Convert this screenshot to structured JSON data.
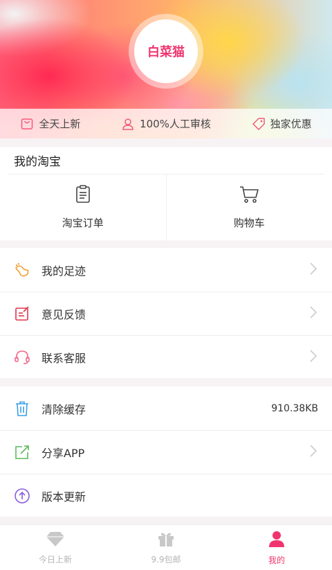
{
  "header": {
    "avatar_text": "白菜猫",
    "features": [
      {
        "icon": "shopping-bag-icon",
        "label": "全天上新"
      },
      {
        "icon": "person-icon",
        "label": "100%人工审核"
      },
      {
        "icon": "tag-icon",
        "label": "独家优惠"
      }
    ]
  },
  "my_taobao": {
    "title": "我的淘宝",
    "items": [
      {
        "icon": "clipboard-icon",
        "label": "淘宝订单"
      },
      {
        "icon": "cart-icon",
        "label": "购物车"
      }
    ]
  },
  "group1": [
    {
      "icon": "footprint-icon",
      "label": "我的足迹",
      "color": "#f0a030"
    },
    {
      "icon": "feedback-icon",
      "label": "意见反馈",
      "color": "#e0344a"
    },
    {
      "icon": "headset-icon",
      "label": "联系客服",
      "color": "#f06a8a"
    }
  ],
  "group2": [
    {
      "icon": "trash-icon",
      "label": "清除缓存",
      "value": "910.38KB",
      "color": "#3aa0e8"
    },
    {
      "icon": "share-icon",
      "label": "分享APP",
      "color": "#5cb85c"
    },
    {
      "icon": "upload-icon",
      "label": "版本更新",
      "color": "#8a5ae0"
    }
  ],
  "tabbar": [
    {
      "icon": "diamond-icon",
      "label": "今日上新",
      "active": false
    },
    {
      "icon": "gift-icon",
      "label": "9.9包邮",
      "active": false
    },
    {
      "icon": "user-icon",
      "label": "我的",
      "active": true
    }
  ],
  "colors": {
    "accent": "#f0356e"
  }
}
